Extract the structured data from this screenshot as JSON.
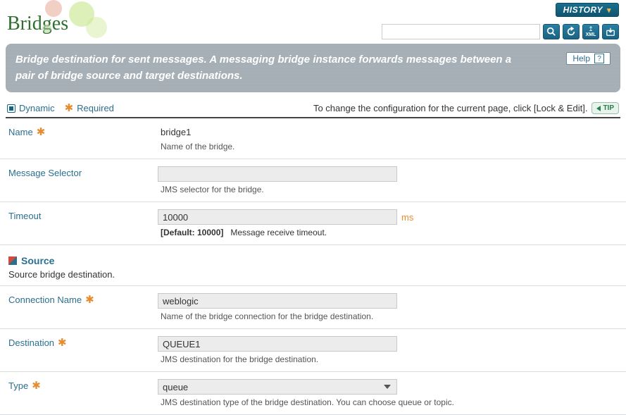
{
  "page": {
    "title": "Bridges"
  },
  "topbar": {
    "history_label": "HISTORY",
    "search_placeholder": ""
  },
  "banner": {
    "text": "Bridge destination for sent messages. A messaging bridge instance forwards messages between a pair of bridge source and target destinations.",
    "help_label": "Help"
  },
  "legend": {
    "dynamic": "Dynamic",
    "required": "Required",
    "tip_text": "To change the configuration for the current page, click [Lock & Edit].",
    "tip_badge": "TIP"
  },
  "fields": {
    "name": {
      "label": "Name",
      "value": "bridge1",
      "desc": "Name of the bridge."
    },
    "message_selector": {
      "label": "Message Selector",
      "value": "",
      "desc": "JMS selector for the bridge."
    },
    "timeout": {
      "label": "Timeout",
      "value": "10000",
      "unit": "ms",
      "default_label": "[Default: 10000]",
      "desc": "Message receive timeout."
    }
  },
  "sections": {
    "source": {
      "title": "Source",
      "desc": "Source bridge destination."
    }
  },
  "source_fields": {
    "connection_name": {
      "label": "Connection Name",
      "value": "weblogic",
      "desc": "Name of the bridge connection for the bridge destination."
    },
    "destination": {
      "label": "Destination",
      "value": "QUEUE1",
      "desc": "JMS destination for the bridge destination."
    },
    "type": {
      "label": "Type",
      "value": "queue",
      "desc": "JMS destination type of the bridge destination. You can choose queue or topic."
    }
  }
}
